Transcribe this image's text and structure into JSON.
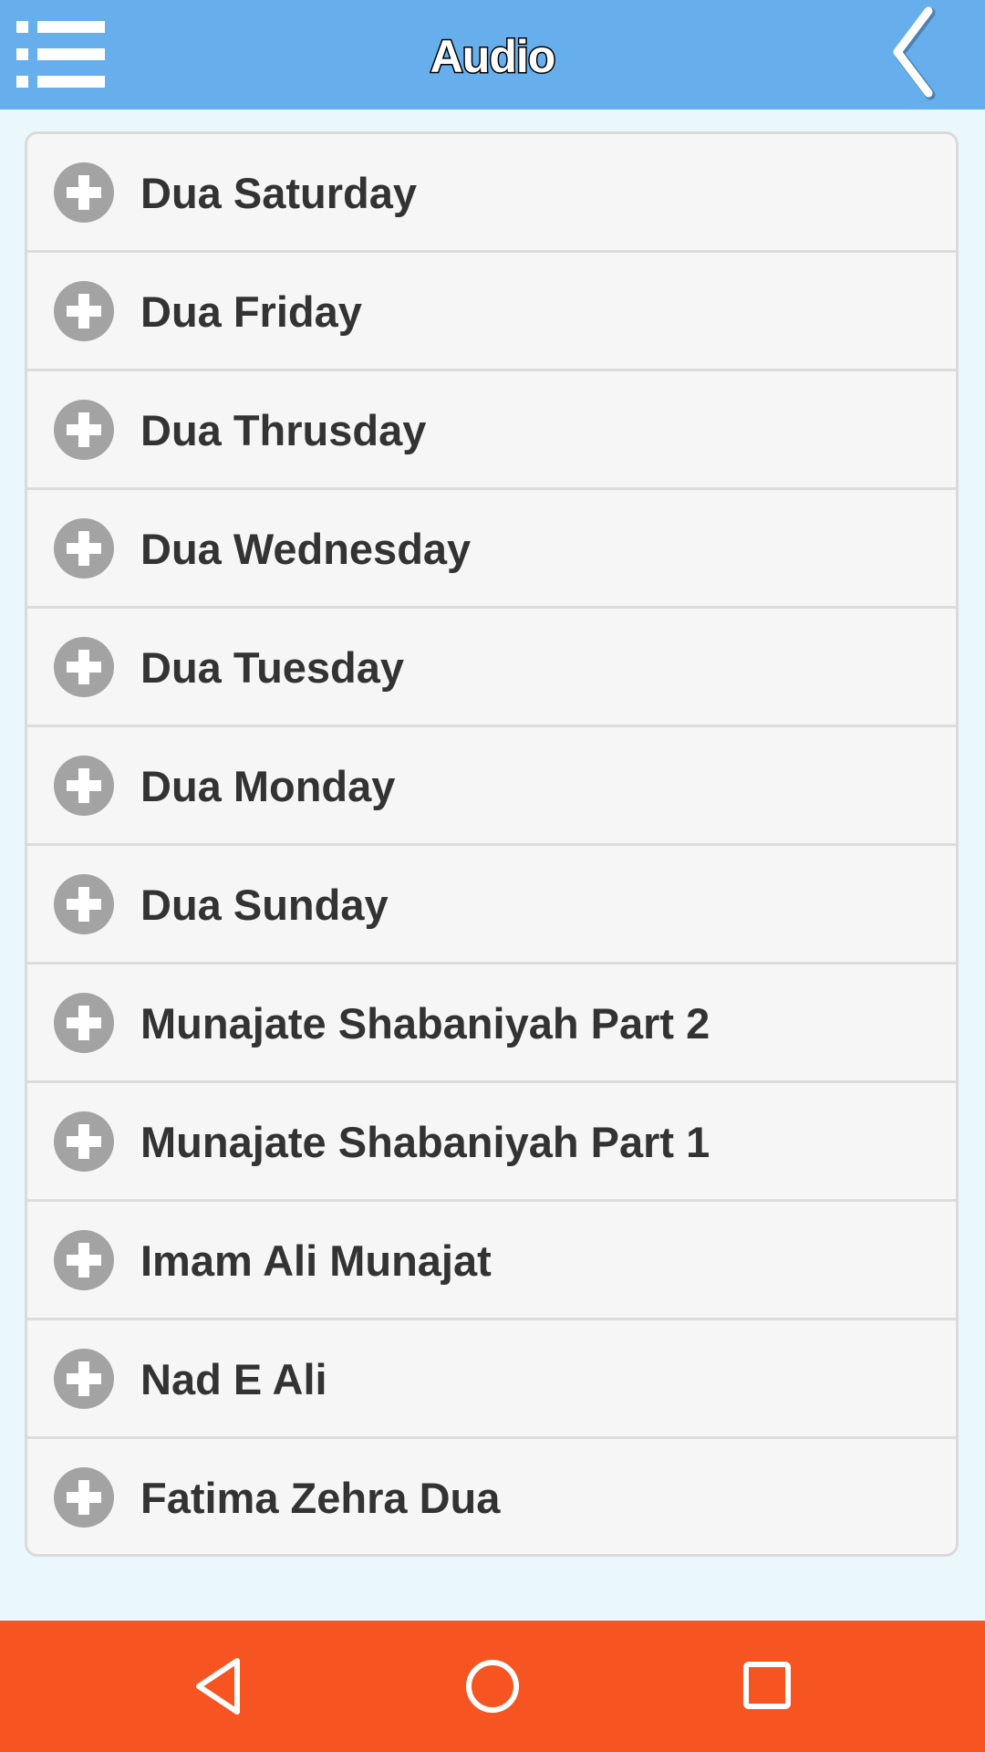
{
  "header": {
    "title": "Audio",
    "menu_icon": "hamburger-list-icon",
    "back_icon": "chevron-left-icon",
    "background_color": "#66aeec"
  },
  "list": {
    "item_icon": "plus-circle-icon",
    "items": [
      {
        "label": "Dua Saturday"
      },
      {
        "label": "Dua Friday"
      },
      {
        "label": "Dua Thrusday"
      },
      {
        "label": "Dua Wednesday"
      },
      {
        "label": "Dua Tuesday"
      },
      {
        "label": "Dua Monday"
      },
      {
        "label": "Dua Sunday"
      },
      {
        "label": "Munajate Shabaniyah Part 2"
      },
      {
        "label": "Munajate Shabaniyah Part 1"
      },
      {
        "label": "Imam Ali Munajat"
      },
      {
        "label": "Nad E Ali"
      },
      {
        "label": "Fatima Zehra Dua"
      }
    ]
  },
  "navbar": {
    "background_color": "#f65421",
    "buttons": [
      "back-triangle-icon",
      "home-circle-icon",
      "recents-square-icon"
    ]
  }
}
